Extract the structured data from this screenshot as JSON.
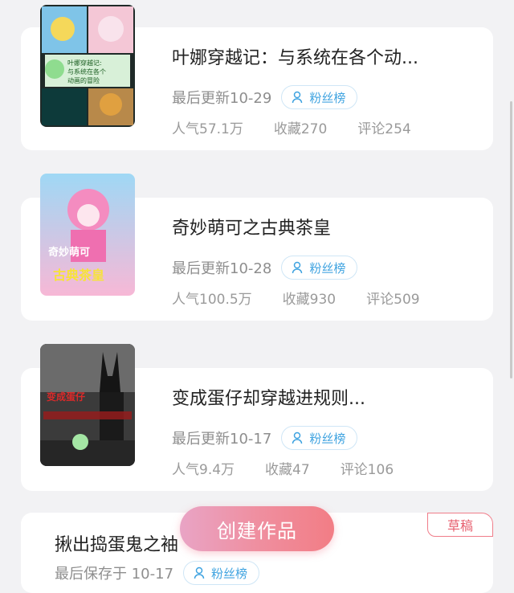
{
  "works": [
    {
      "title": "叶娜穿越记：与系统在各个动...",
      "updated": "最后更新10-29",
      "fan_label": "粉丝榜",
      "popularity": "人气57.1万",
      "favorites": "收藏270",
      "comments": "评论254",
      "cover_text": "叶娜穿越记：与系统在各个动画的冒险"
    },
    {
      "title": "奇妙萌可之古典茶皇",
      "updated": "最后更新10-28",
      "fan_label": "粉丝榜",
      "popularity": "人气100.5万",
      "favorites": "收藏930",
      "comments": "评论509",
      "cover_text": "奇妙萌可 古典茶皇"
    },
    {
      "title": "变成蛋仔却穿越进规则...",
      "updated": "最后更新10-17",
      "fan_label": "粉丝榜",
      "popularity": "人气9.4万",
      "favorites": "收藏47",
      "comments": "评论106",
      "cover_text": "变成蛋仔"
    },
    {
      "title": "揪出捣蛋鬼之袖",
      "updated": "最后保存于 10-17",
      "fan_label": "粉丝榜",
      "badge": "草稿"
    }
  ],
  "create_button": "创建作品",
  "colors": {
    "accent_blue": "#3fa3e0",
    "accent_pink": "#f27d85",
    "draft_red": "#e7606f"
  }
}
